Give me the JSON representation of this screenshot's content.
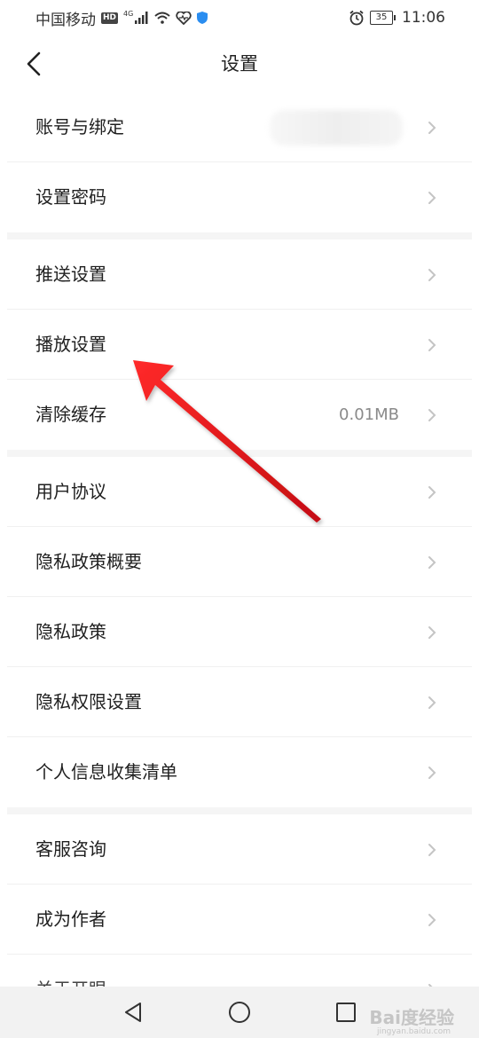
{
  "status_bar": {
    "carrier": "中国移动",
    "hd": "HD",
    "network": "4G",
    "battery": "35",
    "time": "11:06"
  },
  "header": {
    "title": "设置",
    "back_icon": "chevron-left-icon"
  },
  "groups": [
    {
      "items": [
        {
          "label": "账号与绑定",
          "value": ""
        },
        {
          "label": "设置密码",
          "value": ""
        }
      ]
    },
    {
      "items": [
        {
          "label": "推送设置",
          "value": ""
        },
        {
          "label": "播放设置",
          "value": ""
        },
        {
          "label": "清除缓存",
          "value": "0.01MB"
        }
      ]
    },
    {
      "items": [
        {
          "label": "用户协议",
          "value": ""
        },
        {
          "label": "隐私政策概要",
          "value": ""
        },
        {
          "label": "隐私政策",
          "value": ""
        },
        {
          "label": "隐私权限设置",
          "value": ""
        },
        {
          "label": "个人信息收集清单",
          "value": ""
        }
      ]
    },
    {
      "items": [
        {
          "label": "客服咨询",
          "value": ""
        },
        {
          "label": "成为作者",
          "value": ""
        },
        {
          "label": "关于开眼",
          "value": ""
        }
      ]
    }
  ],
  "bottom_nav": {
    "icons": [
      "back-triangle-icon",
      "home-circle-icon",
      "recents-square-icon"
    ]
  },
  "watermark": {
    "text": "Bai度经验",
    "sub": "jingyan.baidu.com"
  },
  "colors": {
    "annotation_arrow": "#e8141b",
    "chevron": "#c4c4c4",
    "divider": "#f0f0f0"
  }
}
